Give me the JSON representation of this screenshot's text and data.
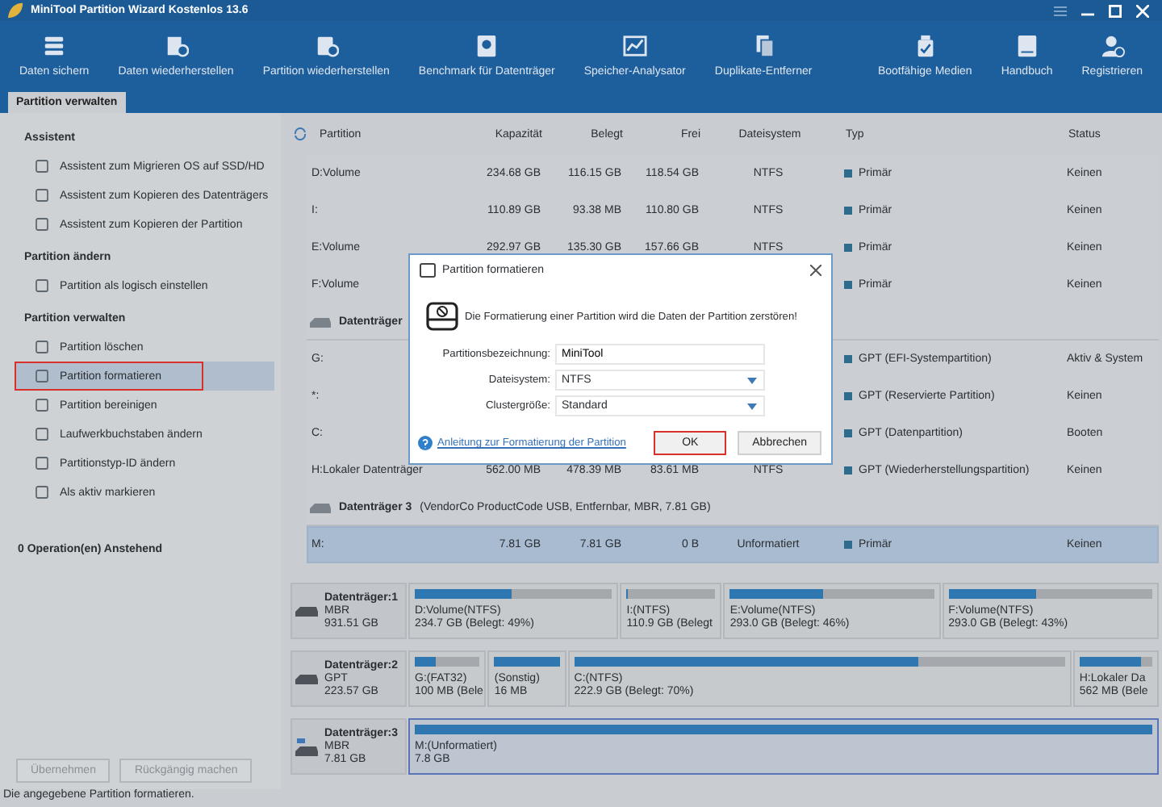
{
  "window": {
    "title": "MiniTool Partition Wizard Kostenlos 13.6"
  },
  "toolbar": [
    {
      "label": "Daten sichern"
    },
    {
      "label": "Daten wiederherstellen"
    },
    {
      "label": "Partition wiederherstellen"
    },
    {
      "label": "Benchmark für Datenträger"
    },
    {
      "label": "Speicher-Analysator"
    },
    {
      "label": "Duplikate-Entferner"
    }
  ],
  "toolbar_right": [
    {
      "label": "Bootfähige Medien"
    },
    {
      "label": "Handbuch"
    },
    {
      "label": "Registrieren"
    }
  ],
  "tabs": [
    {
      "label": "Partition verwalten",
      "selected": true
    }
  ],
  "sidebar": {
    "sections": [
      {
        "title": "Assistent",
        "items": [
          {
            "label": "Assistent zum Migrieren OS auf SSD/HD",
            "selected": false,
            "highlighted": false
          },
          {
            "label": "Assistent zum Kopieren des Datenträgers",
            "selected": false,
            "highlighted": false
          },
          {
            "label": "Assistent zum Kopieren der Partition",
            "selected": false,
            "highlighted": false
          }
        ]
      },
      {
        "title": "Partition ändern",
        "items": [
          {
            "label": "Partition als logisch einstellen",
            "selected": false,
            "highlighted": false
          }
        ]
      },
      {
        "title": "Partition verwalten",
        "items": [
          {
            "label": "Partition löschen",
            "selected": false,
            "highlighted": false
          },
          {
            "label": "Partition formatieren",
            "selected": true,
            "highlighted": true
          },
          {
            "label": "Partition bereinigen",
            "selected": false,
            "highlighted": false
          },
          {
            "label": "Laufwerkbuchstaben ändern",
            "selected": false,
            "highlighted": false
          },
          {
            "label": "Partitionstyp-ID ändern",
            "selected": false,
            "highlighted": false
          },
          {
            "label": "Als aktiv markieren",
            "selected": false,
            "highlighted": false
          }
        ]
      }
    ],
    "pending": "0 Operation(en) Anstehend",
    "buttons": [
      {
        "label": "Übernehmen",
        "disabled": true
      },
      {
        "label": "Rückgängig machen",
        "disabled": true
      }
    ]
  },
  "table": {
    "columns": [
      "Partition",
      "Kapazität",
      "Belegt",
      "Frei",
      "Dateisystem",
      "Typ",
      "Status"
    ],
    "rows": [
      {
        "kind": "partition",
        "selected": false,
        "cells": [
          "D:Volume",
          "234.68 GB",
          "116.15 GB",
          "118.54 GB",
          "NTFS",
          "Primär",
          "Keinen"
        ]
      },
      {
        "kind": "partition",
        "selected": false,
        "cells": [
          "I:",
          "110.89 GB",
          "93.38 MB",
          "110.80 GB",
          "NTFS",
          "Primär",
          "Keinen"
        ]
      },
      {
        "kind": "partition",
        "selected": false,
        "cells": [
          "E:Volume",
          "292.97 GB",
          "135.30 GB",
          "157.66 GB",
          "NTFS",
          "Primär",
          "Keinen"
        ]
      },
      {
        "kind": "partition",
        "selected": false,
        "cells": [
          "F:Volume",
          null,
          null,
          null,
          null,
          "Primär",
          "Keinen"
        ]
      },
      {
        "kind": "disk",
        "title": "Datenträger"
      },
      {
        "kind": "partition",
        "selected": false,
        "cells": [
          "G:",
          null,
          null,
          null,
          null,
          "GPT (EFI-Systempartition)",
          "Aktiv & System"
        ]
      },
      {
        "kind": "partition",
        "selected": false,
        "cells": [
          "*:",
          null,
          null,
          null,
          null,
          "GPT (Reservierte Partition)",
          "Keinen"
        ]
      },
      {
        "kind": "partition",
        "selected": false,
        "cells": [
          "C:",
          null,
          null,
          null,
          null,
          "GPT (Datenpartition)",
          "Booten"
        ]
      },
      {
        "kind": "partition",
        "selected": false,
        "cells": [
          "H:Lokaler Datenträger",
          "562.00 MB",
          "478.39 MB",
          "83.61 MB",
          "NTFS",
          "GPT (Wiederherstellungspartition)",
          "Keinen"
        ]
      },
      {
        "kind": "disk",
        "title": "Datenträger 3",
        "detail": "(VendorCo ProductCode USB, Entfernbar, MBR, 7.81 GB)"
      },
      {
        "kind": "partition",
        "selected": true,
        "cells": [
          "M:",
          "7.81 GB",
          "7.81 GB",
          "0 B",
          "Unformatiert",
          "Primär",
          "Keinen"
        ]
      }
    ]
  },
  "disk_map": [
    {
      "name": "Datenträger:1",
      "style": "MBR",
      "size": "931.51 GB",
      "kind": "hdd",
      "partitions": [
        {
          "label": "D:Volume(NTFS)",
          "detail": "234.7 GB (Belegt: 49%)",
          "level": 0.49,
          "selected": false
        },
        {
          "label": "I:(NTFS)",
          "detail": "110.9 GB (Belegt",
          "level": 0.01,
          "selected": false
        },
        {
          "label": "E:Volume(NTFS)",
          "detail": "293.0 GB (Belegt: 46%)",
          "level": 0.46,
          "selected": false
        },
        {
          "label": "F:Volume(NTFS)",
          "detail": "293.0 GB (Belegt: 43%)",
          "level": 0.43,
          "selected": false
        }
      ]
    },
    {
      "name": "Datenträger:2",
      "style": "GPT",
      "size": "223.57 GB",
      "kind": "hdd",
      "partitions": [
        {
          "label": "G:(FAT32)",
          "detail": "100 MB (Bele",
          "level": 0.32,
          "selected": false
        },
        {
          "label": "(Sonstig)",
          "detail": "16 MB",
          "level": 1,
          "selected": false
        },
        {
          "label": "C:(NTFS)",
          "detail": "222.9 GB (Belegt: 70%)",
          "level": 0.7,
          "selected": false
        },
        {
          "label": "H:Lokaler Da",
          "detail": "562 MB (Bele",
          "level": 0.85,
          "selected": false
        }
      ]
    },
    {
      "name": "Datenträger:3",
      "style": "MBR",
      "size": "7.81 GB",
      "kind": "usb",
      "partitions": [
        {
          "label": "M:(Unformatiert)",
          "detail": "7.8 GB",
          "level": 1,
          "selected": true
        }
      ]
    }
  ],
  "status_bar": "Die angegebene Partition formatieren.",
  "dialog": {
    "title": "Partition formatieren",
    "warning": "Die Formatierung einer Partition wird die Daten der Partition zerstören!",
    "fields": [
      {
        "label": "Partitionsbezeichnung:",
        "value": "MiniTool",
        "kind": "text"
      },
      {
        "label": "Dateisystem:",
        "value": "NTFS",
        "kind": "dropdown"
      },
      {
        "label": "Clustergröße:",
        "value": "Standard",
        "kind": "dropdown"
      }
    ],
    "help_link": "Anleitung zur Formatierung der Partition",
    "buttons": [
      {
        "label": "OK",
        "highlighted": true
      },
      {
        "label": "Abbrechen",
        "highlighted": false
      }
    ]
  }
}
